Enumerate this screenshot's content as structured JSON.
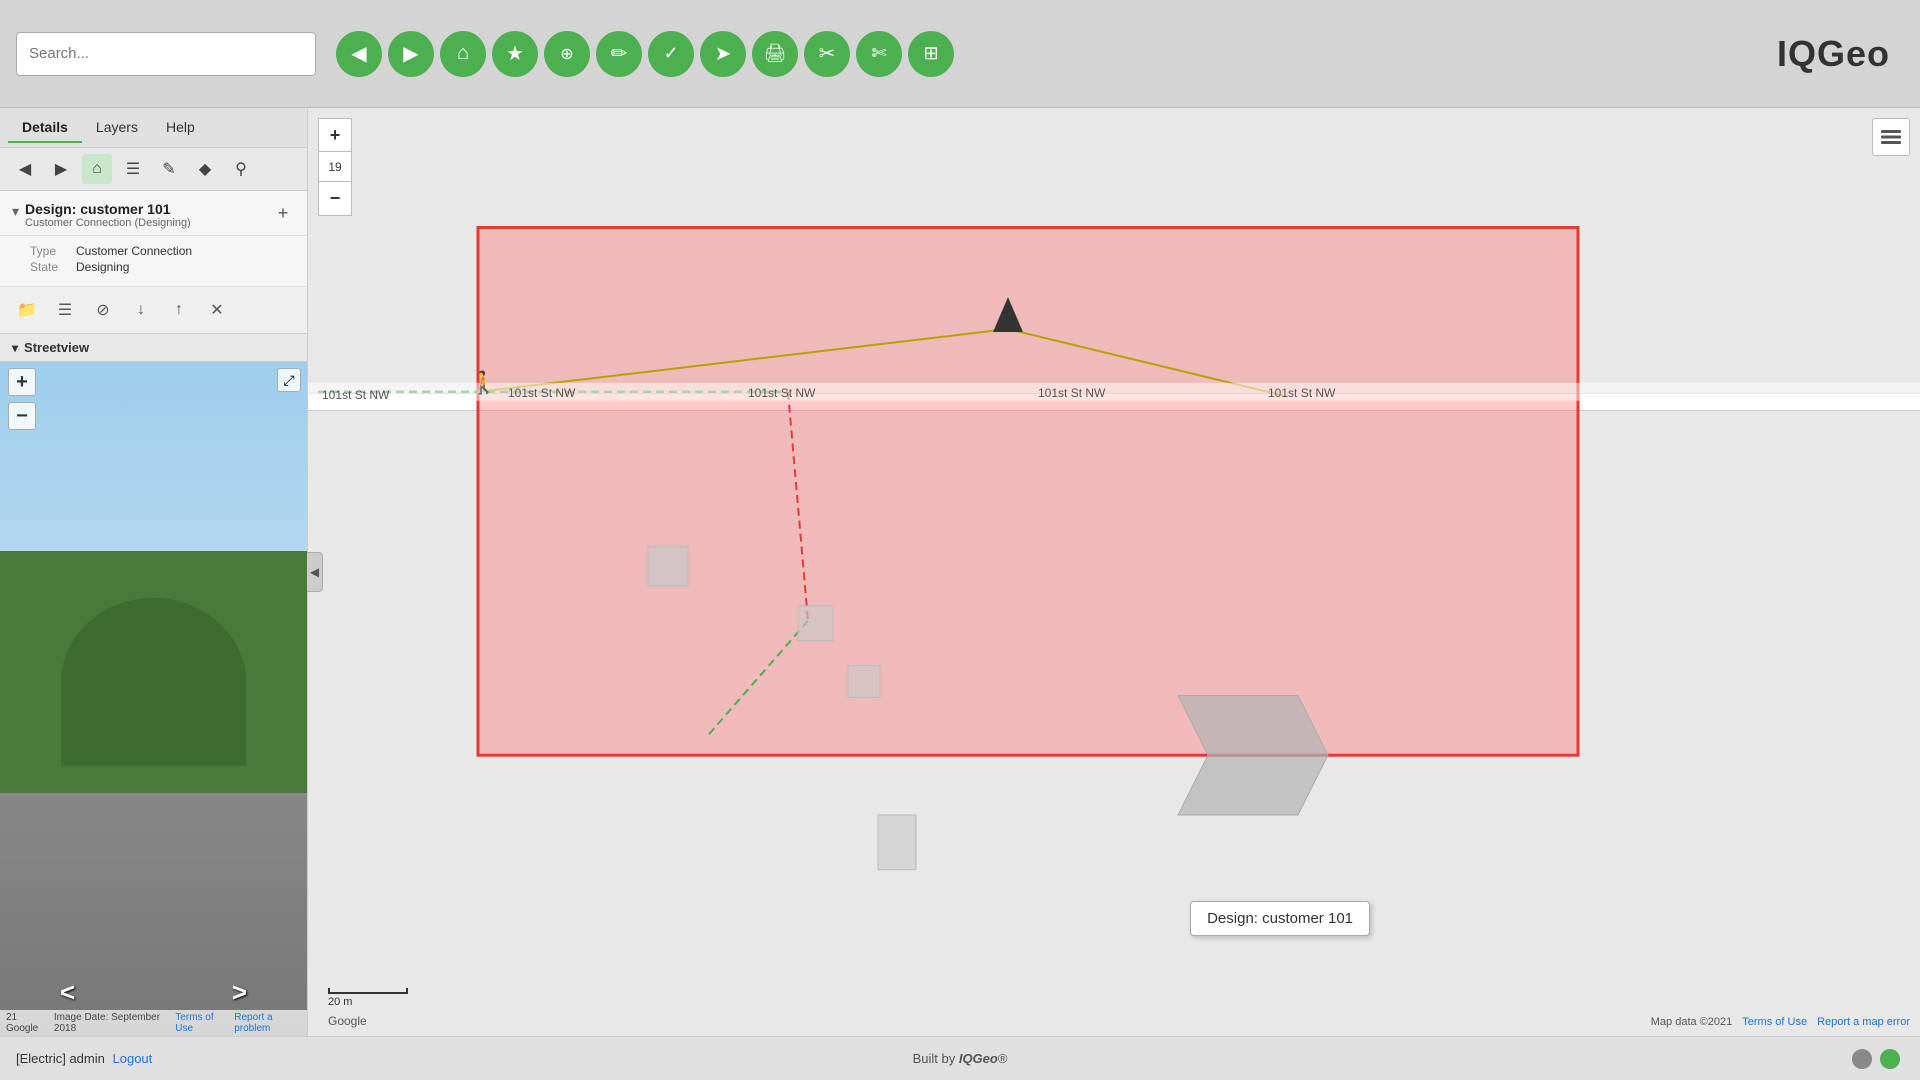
{
  "app": {
    "title": "IQGeo",
    "logo": "IQGeo"
  },
  "top_bar": {
    "search_placeholder": "Search...",
    "toolbar_buttons": [
      {
        "name": "back",
        "icon": "◀",
        "color": "tb-green"
      },
      {
        "name": "forward",
        "icon": "▶",
        "color": "tb-green"
      },
      {
        "name": "home",
        "icon": "⌂",
        "color": "tb-green"
      },
      {
        "name": "bookmark",
        "icon": "★",
        "color": "tb-green"
      },
      {
        "name": "link",
        "icon": "⊕",
        "color": "tb-green"
      },
      {
        "name": "edit-pencil",
        "icon": "✏",
        "color": "tb-green"
      },
      {
        "name": "check",
        "icon": "✓",
        "color": "tb-green"
      },
      {
        "name": "location",
        "icon": "➤",
        "color": "tb-green"
      },
      {
        "name": "print",
        "icon": "🖨",
        "color": "tb-green"
      },
      {
        "name": "cut",
        "icon": "✂",
        "color": "tb-green"
      },
      {
        "name": "scissors",
        "icon": "✄",
        "color": "tb-green"
      },
      {
        "name": "grid",
        "icon": "⊞",
        "color": "tb-green"
      }
    ]
  },
  "panel": {
    "tabs": [
      {
        "label": "Details",
        "active": true
      },
      {
        "label": "Layers",
        "active": false
      },
      {
        "label": "Help",
        "active": false
      }
    ],
    "toolbar": {
      "back_label": "◀",
      "forward_label": "▶",
      "home_label": "⌂",
      "list_label": "☰",
      "edit_label": "✎",
      "diamond_label": "◆",
      "search_label": "⚲"
    },
    "design": {
      "title": "Design: customer 101",
      "subtitle": "Customer Connection (Designing)",
      "type_label": "Type",
      "type_value": "Customer Connection",
      "state_label": "State",
      "state_value": "Designing"
    },
    "actions": {
      "folder": "📁",
      "list": "☰",
      "block": "⊘",
      "down": "↓",
      "up": "↑",
      "close": "✕"
    },
    "streetview": {
      "label": "Streetview",
      "google_text": "21 Google",
      "image_date": "Image Date: September 2018",
      "terms_of_use": "Terms of Use",
      "report_problem": "Report a problem"
    }
  },
  "map": {
    "zoom_level": "19",
    "zoom_in_label": "+",
    "zoom_out_label": "−",
    "scale_label": "20 m",
    "google_label": "Google",
    "attribution": "Map data ©2021",
    "terms_of_use": "Terms of Use",
    "report_error": "Report a map error",
    "design_tooltip": "Design: customer 101",
    "road_labels": [
      "101st St NW",
      "101st St NW",
      "101st St NW",
      "101st St NW"
    ]
  },
  "bottom_bar": {
    "status_prefix": "[Electric] admin",
    "logout_label": "Logout",
    "built_by": "Built by",
    "iqgeo_label": "IQGeo"
  }
}
